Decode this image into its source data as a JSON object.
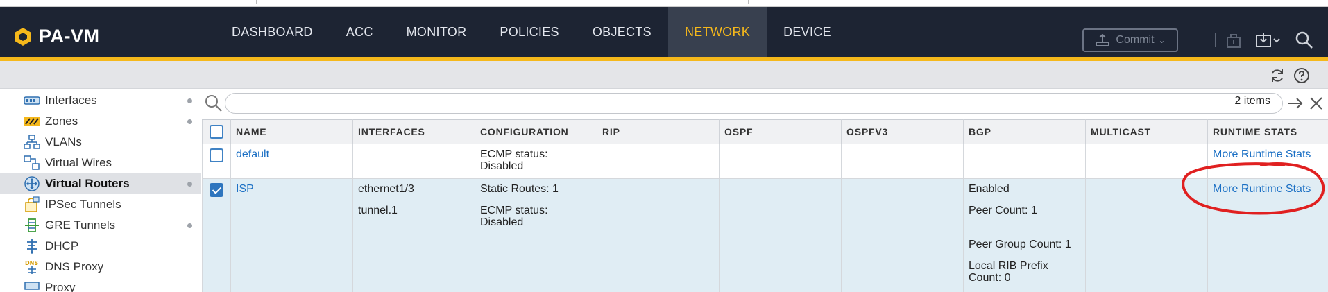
{
  "app": {
    "title": "PA-VM"
  },
  "nav": {
    "items": [
      "DASHBOARD",
      "ACC",
      "MONITOR",
      "POLICIES",
      "OBJECTS",
      "NETWORK",
      "DEVICE"
    ],
    "active": "NETWORK"
  },
  "header": {
    "commit_label": "Commit",
    "commit_state": "disabled"
  },
  "colors": {
    "header_bg": "#1d2433",
    "accent": "#f5b81b",
    "link": "#1a6fc4",
    "selected_row": "#e0edf4",
    "annotation": "#e02020"
  },
  "sidebar": {
    "items": [
      {
        "label": "Interfaces",
        "icon": "interfaces-icon",
        "dot": true
      },
      {
        "label": "Zones",
        "icon": "zones-icon",
        "dot": true
      },
      {
        "label": "VLANs",
        "icon": "vlans-icon",
        "dot": false
      },
      {
        "label": "Virtual Wires",
        "icon": "virtual-wires-icon",
        "dot": false
      },
      {
        "label": "Virtual Routers",
        "icon": "virtual-routers-icon",
        "dot": true,
        "active": true
      },
      {
        "label": "IPSec Tunnels",
        "icon": "ipsec-tunnels-icon",
        "dot": false
      },
      {
        "label": "GRE Tunnels",
        "icon": "gre-tunnels-icon",
        "dot": true
      },
      {
        "label": "DHCP",
        "icon": "dhcp-icon",
        "dot": false
      },
      {
        "label": "DNS Proxy",
        "icon": "dns-proxy-icon",
        "dot": false
      },
      {
        "label": "Proxy",
        "icon": "proxy-icon",
        "dot": false
      }
    ]
  },
  "search": {
    "value": "",
    "placeholder": "",
    "items_count": "2 items"
  },
  "table": {
    "columns": [
      "NAME",
      "INTERFACES",
      "CONFIGURATION",
      "RIP",
      "OSPF",
      "OSPFV3",
      "BGP",
      "MULTICAST",
      "RUNTIME STATS"
    ],
    "rows": [
      {
        "checked": false,
        "name": "default",
        "interfaces": [],
        "configuration": [
          "ECMP status: Disabled"
        ],
        "rip": "",
        "ospf": "",
        "ospfv3": "",
        "bgp": [],
        "multicast": "",
        "runtime_stats": "More Runtime Stats"
      },
      {
        "checked": true,
        "name": "ISP",
        "interfaces": [
          "ethernet1/3",
          "tunnel.1"
        ],
        "configuration": [
          "Static Routes: 1",
          "ECMP status: Disabled"
        ],
        "rip": "",
        "ospf": "",
        "ospfv3": "",
        "bgp": [
          "Enabled",
          "Peer Count: 1",
          "Peer Group Count: 1",
          "Local RIB Prefix Count: 0"
        ],
        "multicast": "",
        "runtime_stats": "More Runtime Stats"
      }
    ]
  }
}
